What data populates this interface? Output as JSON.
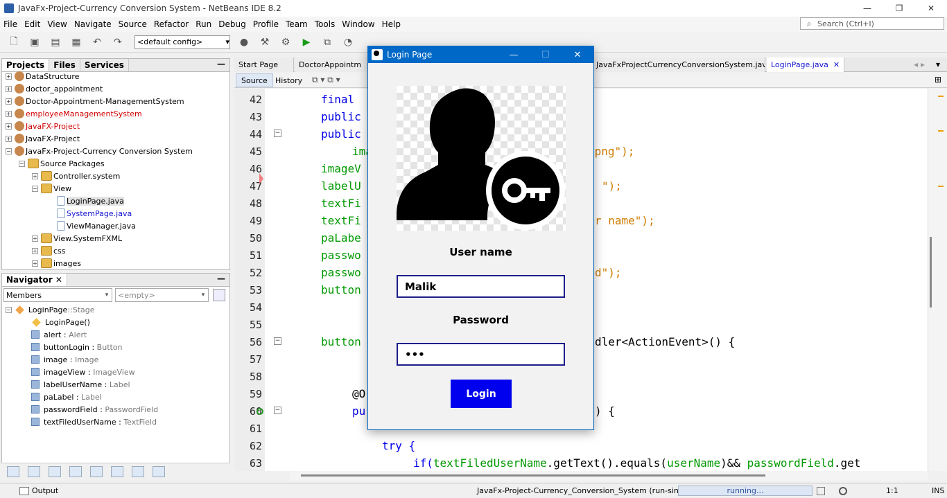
{
  "window": {
    "title": "JavaFx-Project-Currency Conversion System - NetBeans IDE 8.2",
    "controls": [
      "—",
      "❐",
      "✕"
    ]
  },
  "menu": [
    "File",
    "Edit",
    "View",
    "Navigate",
    "Source",
    "Refactor",
    "Run",
    "Debug",
    "Profile",
    "Team",
    "Tools",
    "Window",
    "Help"
  ],
  "search": {
    "placeholder": "Search (Ctrl+I)"
  },
  "toolbar": {
    "config": "<default config>"
  },
  "projects": {
    "tabs": [
      "Projects",
      "Files",
      "Services"
    ],
    "minimize": "—",
    "items": [
      {
        "label": "DataStructure"
      },
      {
        "label": "doctor_appointment"
      },
      {
        "label": "Doctor-Appointment-ManagementSystem"
      },
      {
        "label": "employeeManagementSystem"
      },
      {
        "label": "JavaFX-Project"
      },
      {
        "label": "JavaFX-Project"
      },
      {
        "label": "JavaFx-Project-Currency Conversion System"
      },
      {
        "label": "Source Packages"
      },
      {
        "label": "Controller.system"
      },
      {
        "label": "View"
      },
      {
        "label": "LoginPage.java"
      },
      {
        "label": "SystemPage.java"
      },
      {
        "label": "ViewManager.java"
      },
      {
        "label": "View.SystemFXML"
      },
      {
        "label": "css"
      },
      {
        "label": "images"
      }
    ]
  },
  "navigator": {
    "title": "Navigator",
    "filter": "Members",
    "scope": "<empty>",
    "root": {
      "name": "LoginPage",
      "sep": " :: ",
      "type": "Stage"
    },
    "members": [
      {
        "name": "LoginPage()",
        "type": ""
      },
      {
        "name": "alert",
        "type": "Alert"
      },
      {
        "name": "buttonLogin",
        "type": "Button"
      },
      {
        "name": "image",
        "type": "Image"
      },
      {
        "name": "imageView",
        "type": "ImageView"
      },
      {
        "name": "labelUserName",
        "type": "Label"
      },
      {
        "name": "paLabel",
        "type": "Label"
      },
      {
        "name": "passwordField",
        "type": "PasswordField"
      },
      {
        "name": "textFiledUserName",
        "type": "TextField"
      }
    ]
  },
  "editor": {
    "tabs": [
      "Start Page",
      "DoctorAppointm",
      "JavaFxProjectCurrencyConversionSystem.java",
      "LoginPage.java"
    ],
    "subtabs": [
      "Source",
      "History"
    ],
    "lines": [
      "42",
      "43",
      "44",
      "45",
      "46",
      "47",
      "48",
      "49",
      "50",
      "51",
      "52",
      "53",
      "54",
      "55",
      "56",
      "57",
      "58",
      "59",
      "60",
      "61",
      "62",
      "63"
    ],
    "code": {
      "l42": "final",
      "l43": "public",
      "l44": "public",
      "l45a": "ima",
      "l45b": ".png\");",
      "l46": "imageV",
      "l47a": "labelU",
      "l47b": "\");",
      "l48": "textFi",
      "l49a": "textFi",
      "l49b": "r name\");",
      "l50": "paLabe",
      "l51": "passwo",
      "l52a": "passwo",
      "l52b": "d\");",
      "l53": "button",
      "l56a": "button",
      "l56b": "dler<ActionEvent>() {",
      "l59": "@O",
      "l60a": "pu",
      "l60b": ") {",
      "l62": "try {",
      "l63a": "if(",
      "l63b": "textFiledUserName",
      "l63c": ".getText().equals(",
      "l63d": "userName",
      "l63e": ")&& ",
      "l63f": "passwordField",
      "l63g": ".get"
    }
  },
  "status": {
    "output": "Output",
    "task": "JavaFx-Project-Currency_Conversion_System (run-single)",
    "progress": "running...",
    "position": "1:1",
    "mode": "INS"
  },
  "dialog": {
    "title": "Login Page",
    "controls": [
      "—",
      "☐",
      "✕"
    ],
    "username_label": "User name",
    "username_value": "Malik",
    "password_label": "Password",
    "password_value": "•••",
    "login_label": "Login"
  }
}
